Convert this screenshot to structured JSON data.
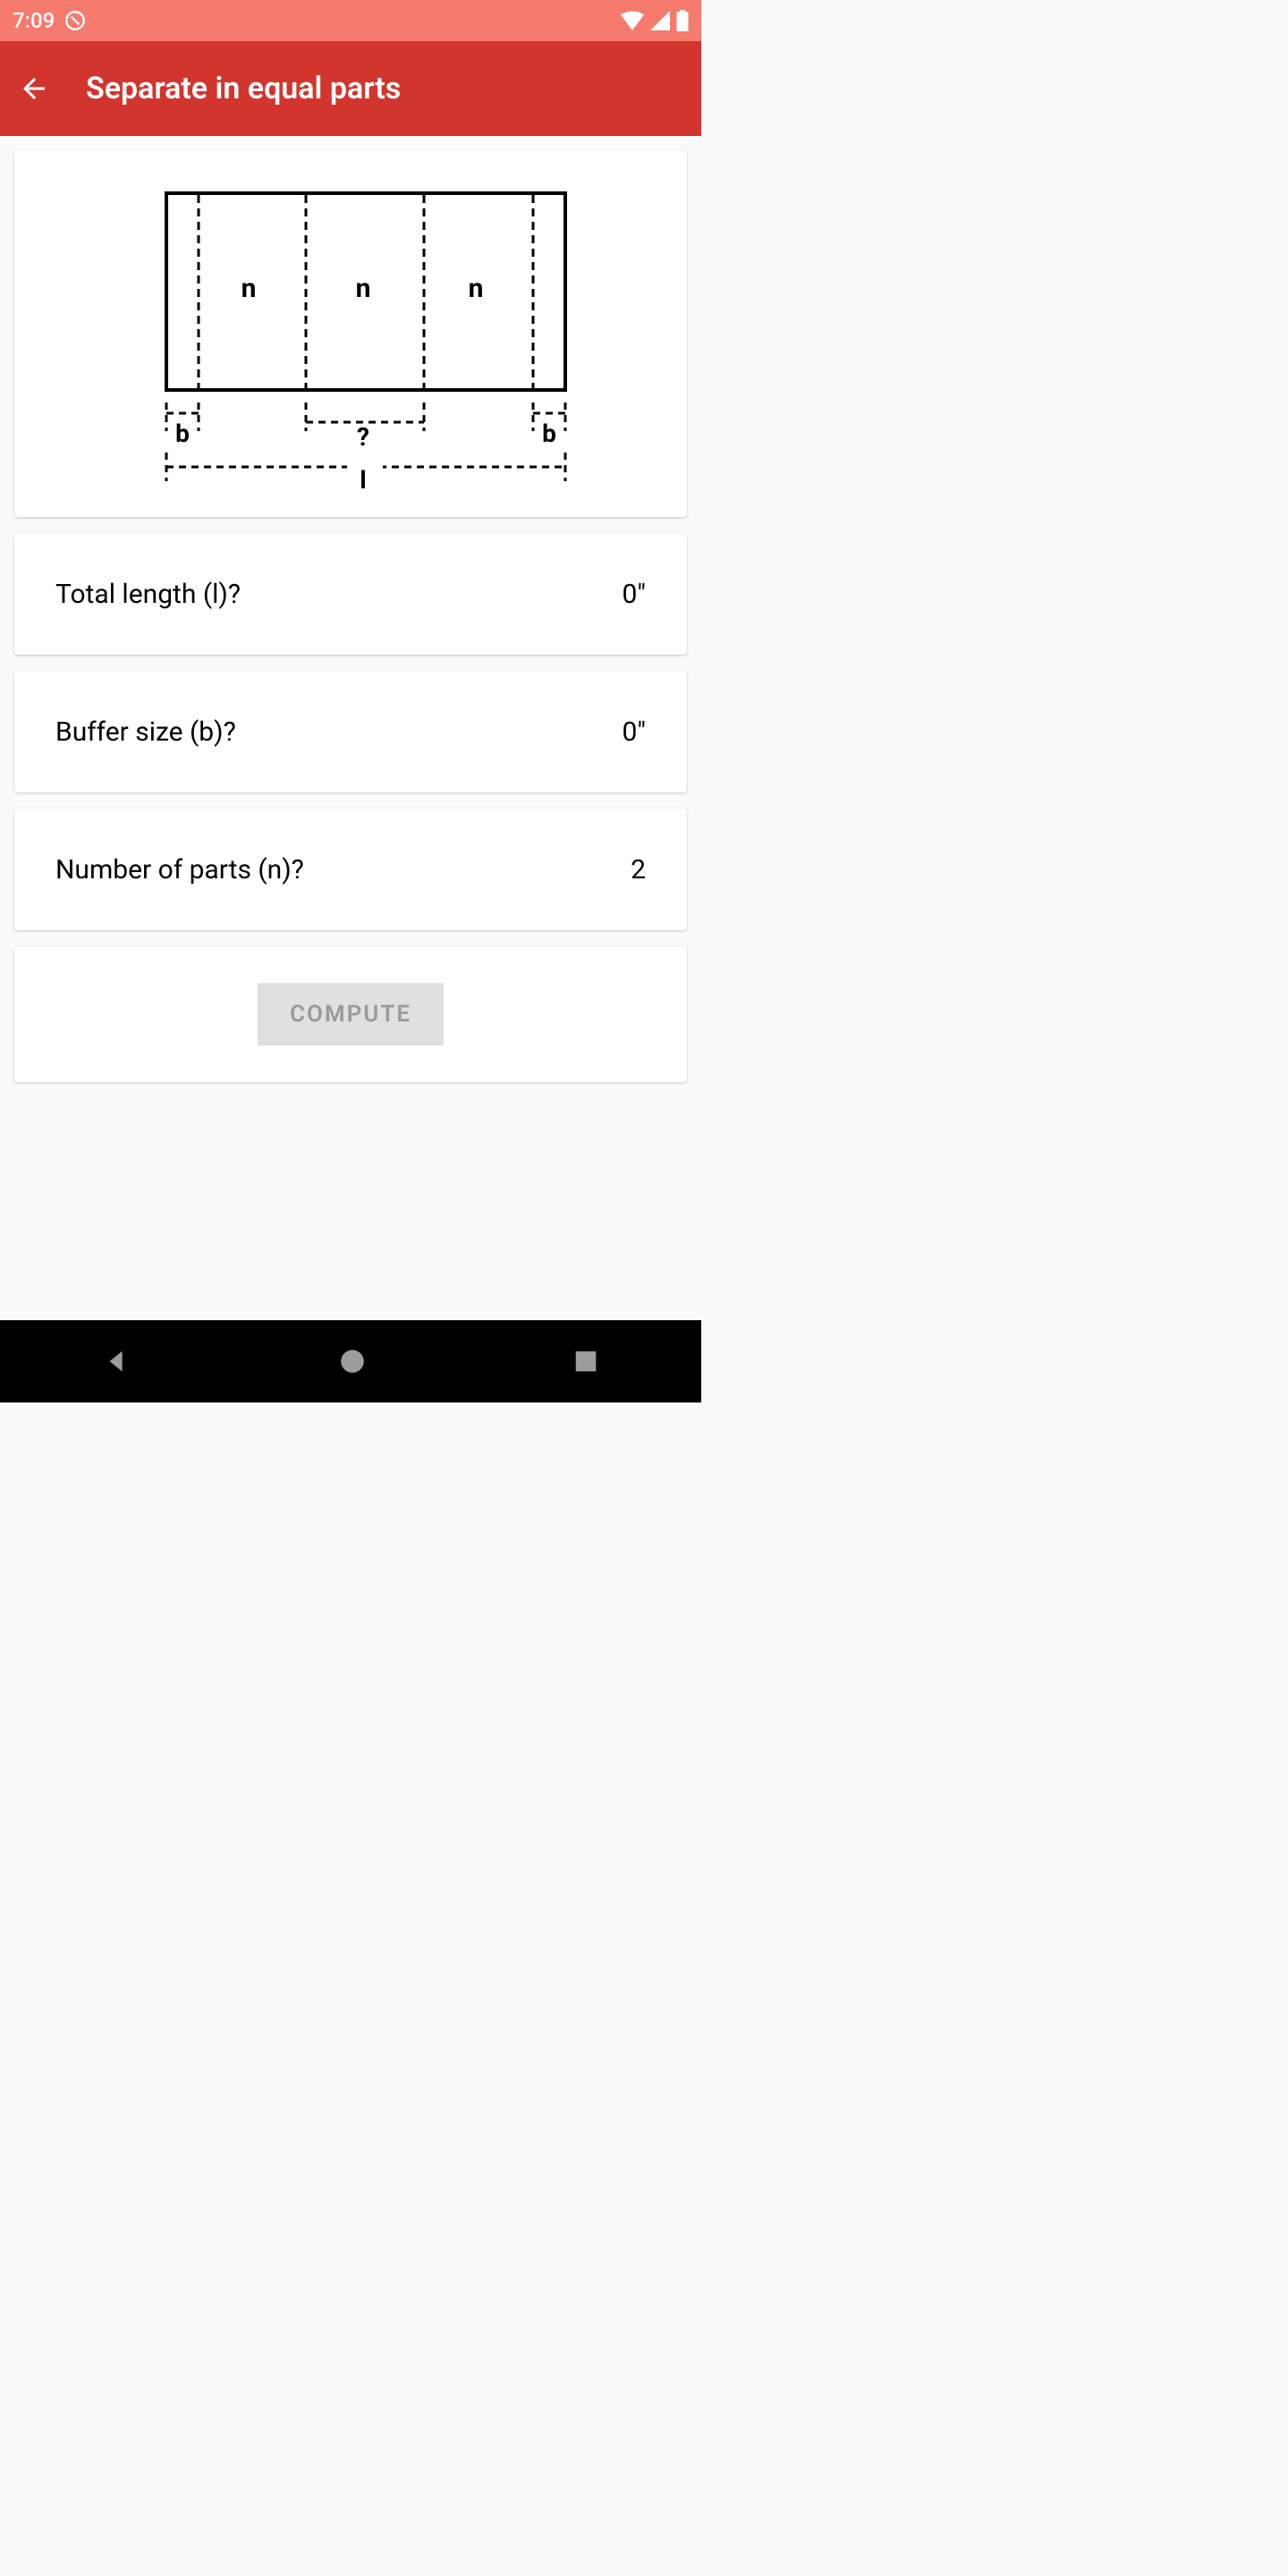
{
  "status": {
    "time": "7:09"
  },
  "header": {
    "title": "Separate in equal parts"
  },
  "diagram": {
    "n": "n",
    "b_left": "b",
    "b_right": "b",
    "question": "?",
    "length": "l"
  },
  "inputs": {
    "total_length": {
      "label": "Total length (l)?",
      "value": "0\""
    },
    "buffer_size": {
      "label": "Buffer size (b)?",
      "value": "0\""
    },
    "num_parts": {
      "label": "Number of parts (n)?",
      "value": "2"
    }
  },
  "actions": {
    "compute_label": "COMPUTE"
  }
}
